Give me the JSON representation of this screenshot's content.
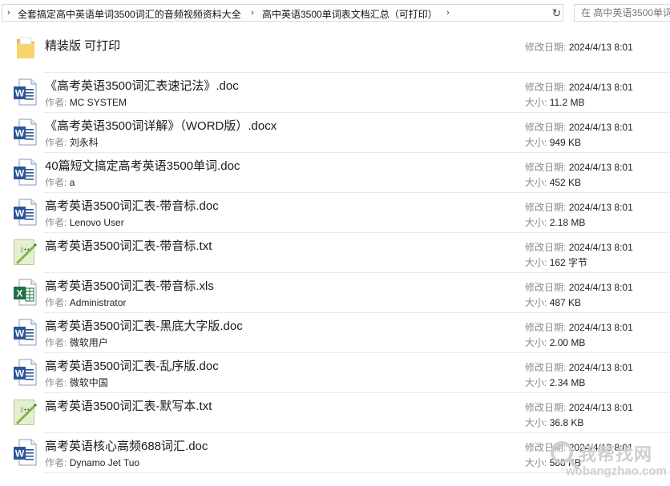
{
  "address_bar": {
    "breadcrumbs": [
      "全套搞定高中英语单词3500词汇的音频视频资料大全",
      "高中英语3500单词表文档汇总（可打印）"
    ],
    "search_placeholder": "在 高中英语3500单词..."
  },
  "labels": {
    "modified": "修改日期:",
    "size": "大小:",
    "author": "作者:"
  },
  "items": [
    {
      "name": "精装版 可打印",
      "type": "folder",
      "modified": "2024/4/13 8:01"
    },
    {
      "name": "《高考英语3500词汇表速记法》.doc",
      "type": "word",
      "author": "MC SYSTEM",
      "modified": "2024/4/13 8:01",
      "size": "11.2 MB"
    },
    {
      "name": "《高考英语3500词详解》（WORD版）.docx",
      "type": "word",
      "author": "刘永科",
      "modified": "2024/4/13 8:01",
      "size": "949 KB"
    },
    {
      "name": "40篇短文搞定高考英语3500单词.doc",
      "type": "word",
      "author": "a",
      "modified": "2024/4/13 8:01",
      "size": "452 KB"
    },
    {
      "name": "高考英语3500词汇表-带音标.doc",
      "type": "word",
      "author": "Lenovo User",
      "modified": "2024/4/13 8:01",
      "size": "2.18 MB"
    },
    {
      "name": "高考英语3500词汇表-带音标.txt",
      "type": "text",
      "modified": "2024/4/13 8:01",
      "size": "162 字节"
    },
    {
      "name": "高考英语3500词汇表-带音标.xls",
      "type": "excel",
      "author": "Administrator",
      "modified": "2024/4/13 8:01",
      "size": "487 KB"
    },
    {
      "name": "高考英语3500词汇表-黑底大字版.doc",
      "type": "word",
      "author": "微软用户",
      "modified": "2024/4/13 8:01",
      "size": "2.00 MB"
    },
    {
      "name": "高考英语3500词汇表-乱序版.doc",
      "type": "word",
      "author": "微软中国",
      "modified": "2024/4/13 8:01",
      "size": "2.34 MB"
    },
    {
      "name": "高考英语3500词汇表-默写本.txt",
      "type": "text",
      "modified": "2024/4/13 8:01",
      "size": "36.8 KB"
    },
    {
      "name": "高考英语核心高频688词汇.doc",
      "type": "word",
      "author": "Dynamo Jet Tuo",
      "modified": "2024/4/13 8:01",
      "size": "588 KB"
    }
  ],
  "watermark": {
    "text": "我帮找网",
    "url": "wobangzhao.com"
  },
  "colors": {
    "word_blue": "#2b5797",
    "excel_green": "#1e7145",
    "folder_yellow": "#f7d46e",
    "txt_green": "#7cb342"
  }
}
